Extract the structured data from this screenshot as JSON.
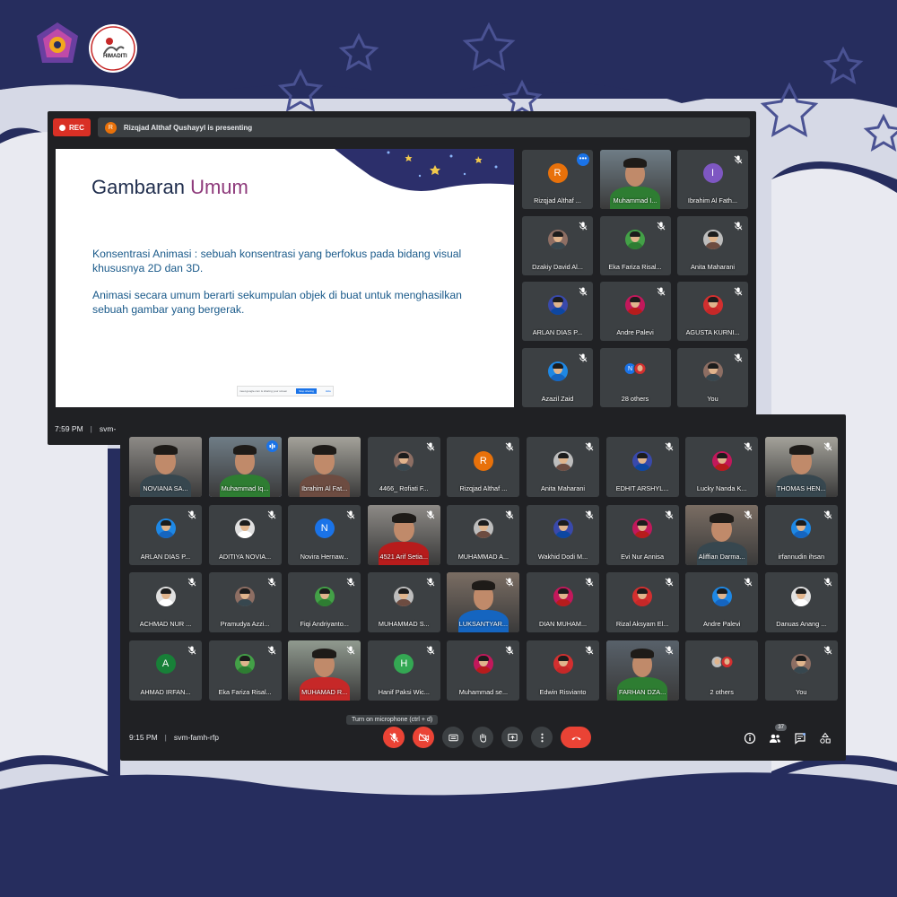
{
  "branding": {
    "logo_left": "org-logo",
    "logo_right_text": "HIMADITI"
  },
  "colors": {
    "background": "#262d5e",
    "meet_dark": "#202124",
    "tile": "#3c4043",
    "accent_blue": "#1a73e8",
    "danger_red": "#ea4335"
  },
  "window1": {
    "rec_label": "REC",
    "presenter_initial": "R",
    "presenting_text": "Rizqjad Althaf Qushayyl is presenting",
    "slide": {
      "title_main": "Gambaran",
      "title_accent": "Umum",
      "paragraph1": "Konsentrasi Animasi : sebuah konsentrasi yang berfokus pada bidang visual khususnya 2D dan 3D.",
      "paragraph2": "Animasi secara umum berarti sekumpulan objek di buat untuk menghasilkan sebuah gambar yang bergerak.",
      "share_bar_text": "meet.google.com is sharing your screen",
      "share_stop": "Stop sharing",
      "share_hide": "Hide"
    },
    "tiles": [
      {
        "name": "Rizqjad Althaf ...",
        "initial": "R",
        "color": "#e8710a",
        "kind": "initial",
        "state": "more"
      },
      {
        "name": "Muhammad I...",
        "kind": "video"
      },
      {
        "name": "Ibrahim Al Fath...",
        "initial": "I",
        "color": "#7e57c2",
        "kind": "initial",
        "muted": true
      },
      {
        "name": "Dzakiy David Al...",
        "kind": "photo",
        "muted": true
      },
      {
        "name": "Eka Fariza Risal...",
        "kind": "photo",
        "muted": true
      },
      {
        "name": "Anita Maharani",
        "kind": "photo",
        "muted": true
      },
      {
        "name": "ARLAN DIAS P...",
        "kind": "photo",
        "muted": true
      },
      {
        "name": "Andre Palevi",
        "kind": "photo",
        "muted": true
      },
      {
        "name": "AGUSTA KURNI...",
        "kind": "photo",
        "muted": true
      },
      {
        "name": "Azazil Zaid",
        "kind": "photo",
        "muted": true
      },
      {
        "name": "28 others",
        "kind": "others",
        "mini_initial": "N"
      },
      {
        "name": "You",
        "kind": "photo",
        "muted": true
      }
    ],
    "time": "7:59 PM",
    "meeting_code": "svm-"
  },
  "window2": {
    "tiles": [
      {
        "name": "NOVIANA SA...",
        "kind": "video"
      },
      {
        "name": "Muhammad Iq...",
        "kind": "video",
        "state": "speaking"
      },
      {
        "name": "Ibrahim Al Fat...",
        "kind": "video"
      },
      {
        "name": "4466_ Rofiati F...",
        "kind": "photo",
        "muted": true
      },
      {
        "name": "Rizqjad Althaf ...",
        "initial": "R",
        "color": "#e8710a",
        "kind": "initial",
        "muted": true
      },
      {
        "name": "Anita Maharani",
        "kind": "photo",
        "muted": true
      },
      {
        "name": "EDHIT ARSHYL...",
        "kind": "photo",
        "muted": true
      },
      {
        "name": "Lucky Nanda K...",
        "kind": "photo",
        "muted": true
      },
      {
        "name": "THOMAS HEN...",
        "kind": "video",
        "muted": true
      },
      {
        "name": "ARLAN DIAS P...",
        "kind": "photo",
        "muted": true
      },
      {
        "name": "ADITIYA NOVIA...",
        "kind": "photo",
        "muted": true
      },
      {
        "name": "Novira Hernaw...",
        "initial": "N",
        "color": "#1a73e8",
        "kind": "initial",
        "muted": true
      },
      {
        "name": "4521 Arif Setia...",
        "kind": "video",
        "muted": true
      },
      {
        "name": "MUHAMMAD A...",
        "kind": "photo",
        "muted": true
      },
      {
        "name": "Wakhid Dodi M...",
        "kind": "photo",
        "muted": true
      },
      {
        "name": "Evi Nur Annisa",
        "kind": "photo",
        "muted": true
      },
      {
        "name": "Aliffian Darma...",
        "kind": "video",
        "muted": true
      },
      {
        "name": "irfannudin ihsan",
        "kind": "photo",
        "muted": true
      },
      {
        "name": "ACHMAD NUR ...",
        "kind": "photo",
        "muted": true
      },
      {
        "name": "Pramudya Azzi...",
        "kind": "photo",
        "muted": true
      },
      {
        "name": "Fiqi Andriyanto...",
        "kind": "photo",
        "muted": true
      },
      {
        "name": "MUHAMMAD S...",
        "kind": "photo",
        "muted": true
      },
      {
        "name": "LUKSANTYAR...",
        "kind": "video",
        "muted": true
      },
      {
        "name": "DIAN MUHAM...",
        "kind": "photo",
        "muted": true
      },
      {
        "name": "Rizal Aksyam El...",
        "kind": "photo",
        "muted": true
      },
      {
        "name": "Andre Palevi",
        "kind": "photo",
        "muted": true
      },
      {
        "name": "Danuas Anang ...",
        "kind": "photo",
        "muted": true
      },
      {
        "name": "AHMAD IRFAN...",
        "initial": "A",
        "color": "#188038",
        "kind": "initial",
        "muted": true
      },
      {
        "name": "Eka Fariza Risal...",
        "kind": "photo",
        "muted": true
      },
      {
        "name": "MUHAMAD R...",
        "kind": "video",
        "muted": true
      },
      {
        "name": "Hanif Paksi Wic...",
        "initial": "H",
        "color": "#34a853",
        "kind": "initial",
        "muted": true
      },
      {
        "name": "Muhammad se...",
        "kind": "photo",
        "muted": true
      },
      {
        "name": "Edwin Risvianto",
        "kind": "photo",
        "muted": true
      },
      {
        "name": "FARHAN DZA...",
        "kind": "video",
        "muted": true
      },
      {
        "name": "2 others",
        "kind": "others2"
      },
      {
        "name": "You",
        "kind": "photo",
        "muted": true
      }
    ],
    "time": "9:15 PM",
    "meeting_code": "svm-famh-rfp",
    "tooltip": "Turn on microphone (ctrl + d)",
    "controls": [
      "mic-off",
      "camera-off",
      "captions",
      "raise-hand",
      "present",
      "more",
      "hang-up"
    ],
    "people_count": "37",
    "right_controls": [
      "info",
      "people",
      "chat",
      "activities"
    ]
  }
}
